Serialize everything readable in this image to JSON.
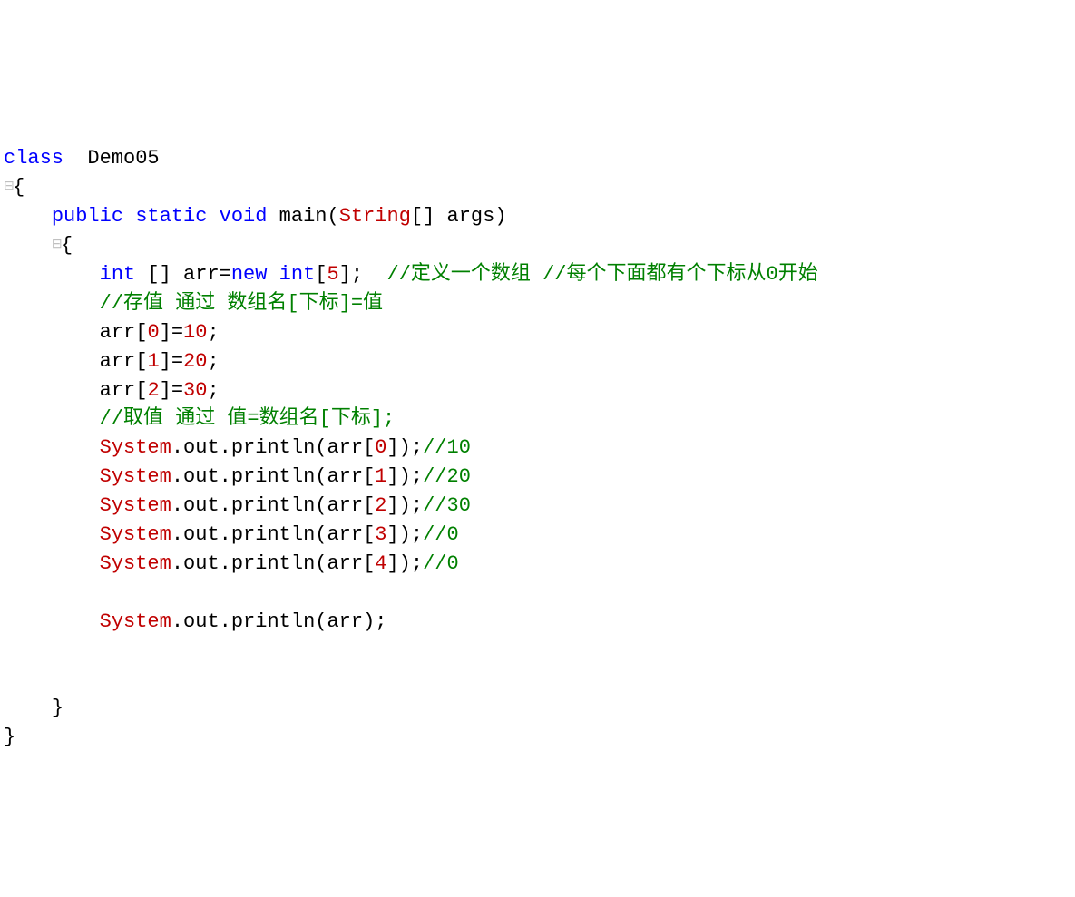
{
  "lines": {
    "l1": {
      "kw1": "class",
      "ws1": "  ",
      "name": "Demo05"
    },
    "l2": {
      "g": "⊟",
      "brace": "{"
    },
    "l3": {
      "kw1": "public",
      "kw2": "static",
      "kw3": "void",
      "fn": "main",
      "lp": "(",
      "ty": "String",
      "arr": "[]",
      "sp": " ",
      "arg": "args",
      "rp": ")"
    },
    "l4": {
      "g": "⊟",
      "brace": "{"
    },
    "l5": {
      "kw": "int",
      "sp1": " [] arr=",
      "kw2": "new",
      "sp2": " ",
      "kw3": "int",
      "arr": "[",
      "n": "5",
      "arr2": "];  ",
      "c1": "//定义一个数组 //每个下面都有个下标从0开始"
    },
    "l6": {
      "c": "//存值 通过 数组名[下标]=值"
    },
    "l7": {
      "t": "arr[",
      "n": "0",
      "t2": "]=",
      "v": "10",
      "t3": ";"
    },
    "l8": {
      "t": "arr[",
      "n": "1",
      "t2": "]=",
      "v": "20",
      "t3": ";"
    },
    "l9": {
      "t": "arr[",
      "n": "2",
      "t2": "]=",
      "v": "30",
      "t3": ";"
    },
    "l10": {
      "c": "//取值 通过 值=数组名[下标];"
    },
    "l11": {
      "sys": "System",
      "t1": ".out.println(arr[",
      "n": "0",
      "t2": "]);",
      "c": "//10"
    },
    "l12": {
      "sys": "System",
      "t1": ".out.println(arr[",
      "n": "1",
      "t2": "]);",
      "c": "//20"
    },
    "l13": {
      "sys": "System",
      "t1": ".out.println(arr[",
      "n": "2",
      "t2": "]);",
      "c": "//30"
    },
    "l14": {
      "sys": "System",
      "t1": ".out.println(arr[",
      "n": "3",
      "t2": "]);",
      "c": "//0"
    },
    "l15": {
      "sys": "System",
      "t1": ".out.println(arr[",
      "n": "4",
      "t2": "]);",
      "c": "//0"
    },
    "l16": {
      "blank": ""
    },
    "l17": {
      "sys": "System",
      "t1": ".out.println(arr);"
    },
    "l18": {
      "blank": ""
    },
    "l19": {
      "blank": ""
    },
    "l20": {
      "brace": "}"
    },
    "l21": {
      "brace": "}"
    }
  }
}
